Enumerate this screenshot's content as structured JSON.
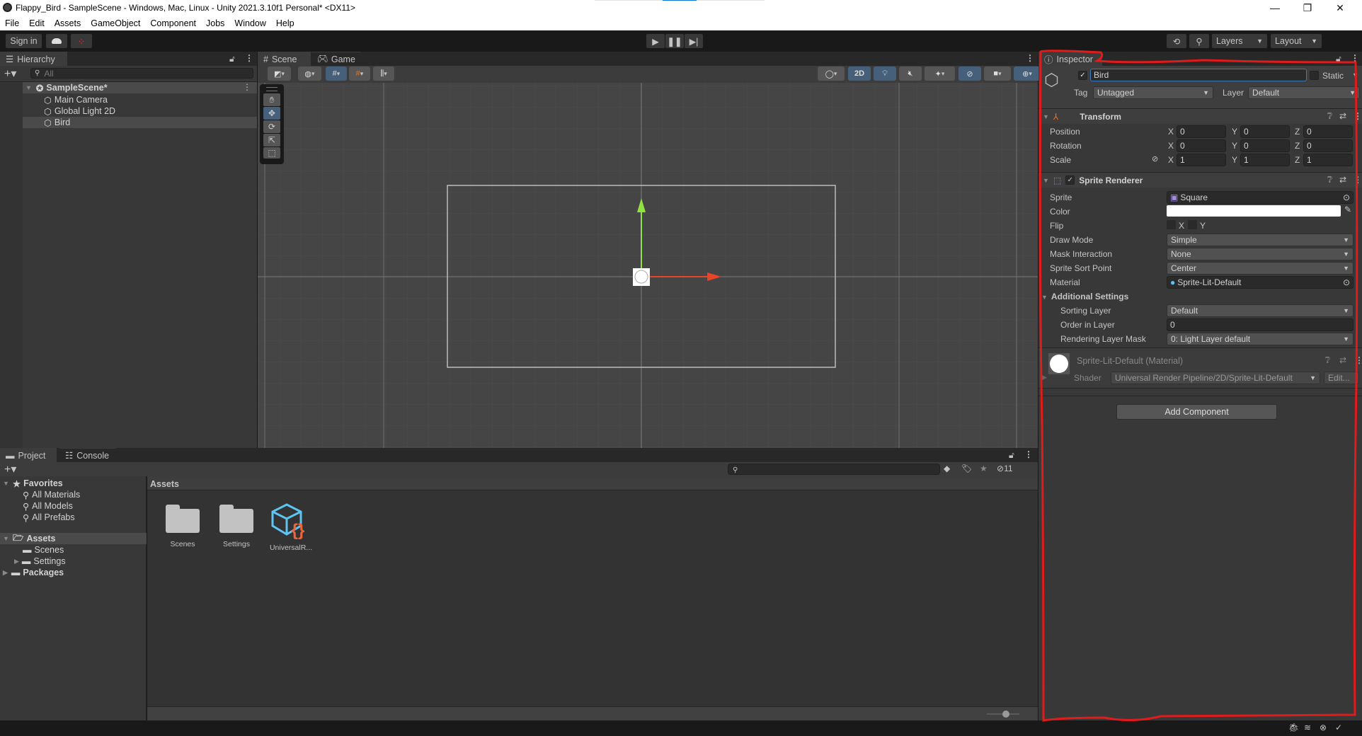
{
  "window": {
    "title": "Flappy_Bird - SampleScene - Windows, Mac, Linux - Unity 2021.3.10f1 Personal* <DX11>",
    "controls": {
      "minimize": "—",
      "maximize": "❐",
      "close": "✕"
    }
  },
  "menu": [
    "File",
    "Edit",
    "Assets",
    "GameObject",
    "Component",
    "Jobs",
    "Window",
    "Help"
  ],
  "toolbar": {
    "sign_in": "Sign in",
    "layers": "Layers",
    "layout": "Layout"
  },
  "hierarchy": {
    "tab": "Hierarchy",
    "search_placeholder": "All",
    "scene": "SampleScene*",
    "items": [
      "Main Camera",
      "Global Light 2D",
      "Bird"
    ],
    "selected": "Bird"
  },
  "scene_view": {
    "tabs": [
      "Scene",
      "Game"
    ],
    "active_tab": "Scene",
    "mode_2d": "2D",
    "tools": [
      "hand",
      "move",
      "rotate",
      "scale",
      "rect",
      "transform"
    ],
    "active_tool": "move"
  },
  "project": {
    "tabs": [
      "Project",
      "Console"
    ],
    "hidden_count": "11",
    "tree": {
      "favorites": {
        "label": "Favorites",
        "items": [
          "All Materials",
          "All Models",
          "All Prefabs"
        ]
      },
      "assets": {
        "label": "Assets",
        "items": [
          "Scenes",
          "Settings"
        ]
      },
      "packages": "Packages"
    },
    "breadcrumb": "Assets",
    "files": [
      {
        "name": "Scenes",
        "type": "folder"
      },
      {
        "name": "Settings",
        "type": "folder"
      },
      {
        "name": "UniversalR...",
        "type": "render-pipeline-asset"
      }
    ]
  },
  "inspector": {
    "tab": "Inspector",
    "object_name": "Bird",
    "active": true,
    "static_label": "Static",
    "tag_label": "Tag",
    "tag_value": "Untagged",
    "layer_label": "Layer",
    "layer_value": "Default",
    "transform": {
      "title": "Transform",
      "rows": [
        {
          "label": "Position",
          "x": "0",
          "y": "0",
          "z": "0"
        },
        {
          "label": "Rotation",
          "x": "0",
          "y": "0",
          "z": "0"
        },
        {
          "label": "Scale",
          "x": "1",
          "y": "1",
          "z": "1"
        }
      ]
    },
    "sprite_renderer": {
      "title": "Sprite Renderer",
      "enabled": true,
      "sprite_label": "Sprite",
      "sprite": "Square",
      "color_label": "Color",
      "color": "#ffffff",
      "flip_label": "Flip",
      "flip_x": "X",
      "flip_y": "Y",
      "draw_mode_label": "Draw Mode",
      "draw_mode": "Simple",
      "mask_label": "Mask Interaction",
      "mask": "None",
      "sort_point_label": "Sprite Sort Point",
      "sort_point": "Center",
      "material_label": "Material",
      "material": "Sprite-Lit-Default",
      "additional": "Additional Settings",
      "sorting_layer_label": "Sorting Layer",
      "sorting_layer": "Default",
      "order_label": "Order in Layer",
      "order": "0",
      "rlm_label": "Rendering Layer Mask",
      "rlm": "0: Light Layer default"
    },
    "material": {
      "title": "Sprite-Lit-Default (Material)",
      "shader_label": "Shader",
      "shader": "Universal Render Pipeline/2D/Sprite-Lit-Default",
      "edit": "Edit..."
    },
    "add_component": "Add Component"
  },
  "colors": {
    "annotation": "#e01b1b",
    "accent_blue": "#46607c",
    "gizmo_x": "#e8442a",
    "gizmo_y": "#8fe33c"
  }
}
